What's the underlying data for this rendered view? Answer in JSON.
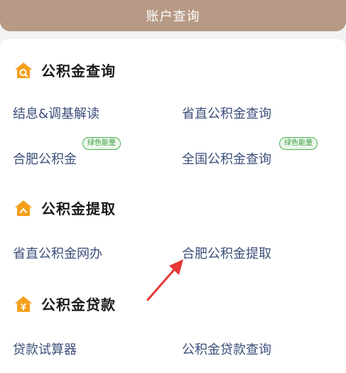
{
  "header": {
    "title": "账户查询"
  },
  "sections": [
    {
      "title": "公积金查询",
      "icon": "house-search-icon",
      "items": [
        {
          "label": "结息&调基解读"
        },
        {
          "label": "省直公积金查询"
        },
        {
          "label": "合肥公积金",
          "badge": "绿色能量"
        },
        {
          "label": "全国公积金查询",
          "badge": "绿色能量"
        }
      ]
    },
    {
      "title": "公积金提取",
      "icon": "house-withdraw-icon",
      "items": [
        {
          "label": "省直公积金网办"
        },
        {
          "label": "合肥公积金提取"
        }
      ]
    },
    {
      "title": "公积金贷款",
      "icon": "house-loan-icon",
      "items": [
        {
          "label": "贷款试算器"
        },
        {
          "label": "公积金贷款查询"
        }
      ]
    }
  ],
  "colors": {
    "header_bg": "#b79a85",
    "icon_orange": "#f5a01d",
    "link_text": "#3c4e7a",
    "badge_green": "#4caf50",
    "arrow_red": "#e53935"
  }
}
